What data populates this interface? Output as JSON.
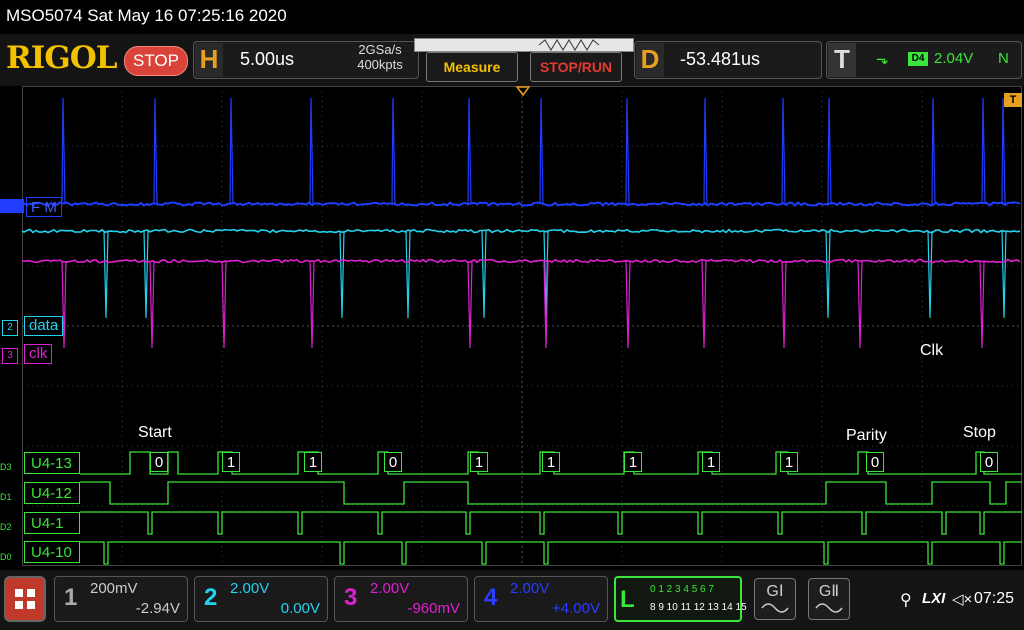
{
  "title": "MSO5074  Sat May 16 07:25:16 2020",
  "brand": "RIGOL",
  "run_state": "STOP",
  "horizontal": {
    "letter": "H",
    "timebase": "5.00us",
    "sample_rate": "2GSa/s",
    "memory": "400kpts"
  },
  "buttons": {
    "measure": "Measure",
    "stop_run": "STOP/RUN"
  },
  "delay": {
    "letter": "D",
    "value": "-53.481us"
  },
  "trigger": {
    "letter": "T",
    "edge_glyph": "⬎",
    "source": "D4",
    "level": "2.04V",
    "mode": "N",
    "marker": "T"
  },
  "channels": {
    "ch1_tag": "F M",
    "ch2_num": "2",
    "ch2_tag": "data",
    "ch3_num": "3",
    "ch3_tag": "clk"
  },
  "digital": [
    {
      "id": "D3",
      "label": "U4-13"
    },
    {
      "id": "D1",
      "label": "U4-12"
    },
    {
      "id": "D2",
      "label": "U4-1"
    },
    {
      "id": "D0",
      "label": "U4-10"
    }
  ],
  "annotations": {
    "start": "Start",
    "parity": "Parity",
    "stop": "Stop",
    "clk": "Clk"
  },
  "bits": [
    "0",
    "1",
    "1",
    "0",
    "1",
    "1",
    "1",
    "1",
    "1",
    "0",
    "0"
  ],
  "bottom": {
    "ch1": {
      "num": "1",
      "scale": "200mV",
      "offset": "-2.94V",
      "color": "#aaaaaa"
    },
    "ch2": {
      "num": "2",
      "scale": "2.00V",
      "offset": "0.00V",
      "color": "#22d3ee"
    },
    "ch3": {
      "num": "3",
      "scale": "2.00V",
      "offset": "-960mV",
      "color": "#e020d0"
    },
    "ch4": {
      "num": "4",
      "scale": "2.00V",
      "offset": "+4.00V",
      "color": "#2a3cff"
    },
    "la": {
      "letter": "L",
      "row1": "0 1 2 3  4 5 6 7",
      "row2": "8 9 10 11 12 13 14 15"
    },
    "g1": "GⅠ",
    "g2": "GⅡ",
    "lxi": "LXI",
    "time": "07:25"
  },
  "colors": {
    "ch1": "#1f3cff",
    "ch2": "#22d3ee",
    "ch3": "#e020d0",
    "digital": "#39e639",
    "accent": "#f2c200"
  }
}
